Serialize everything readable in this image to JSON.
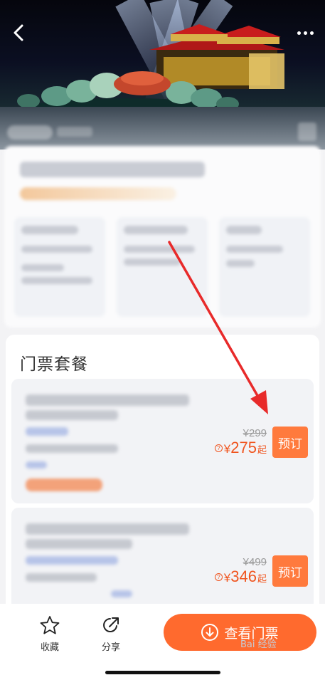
{
  "nav": {
    "back_icon": "chevron-left-icon",
    "more_icon": "more-horizontal-icon"
  },
  "tickets": {
    "title": "门票套餐",
    "items": [
      {
        "original_price": "¥299",
        "currency": "¥",
        "price": "275",
        "price_suffix": "起",
        "book_label": "预订"
      },
      {
        "original_price": "¥499",
        "currency": "¥",
        "price": "346",
        "price_suffix": "起",
        "book_label": "预订"
      }
    ]
  },
  "bottom_bar": {
    "favorite_label": "收藏",
    "favorite_icon": "star-outline-icon",
    "share_label": "分享",
    "share_icon": "share-arrow-icon",
    "view_tickets_label": "查看门票",
    "view_tickets_icon": "arrow-down-circle-icon"
  },
  "watermark": "Bai 经验",
  "colors": {
    "accent": "#ff6a2e",
    "price": "#f0541e",
    "annotation_arrow": "#e82a2a"
  }
}
